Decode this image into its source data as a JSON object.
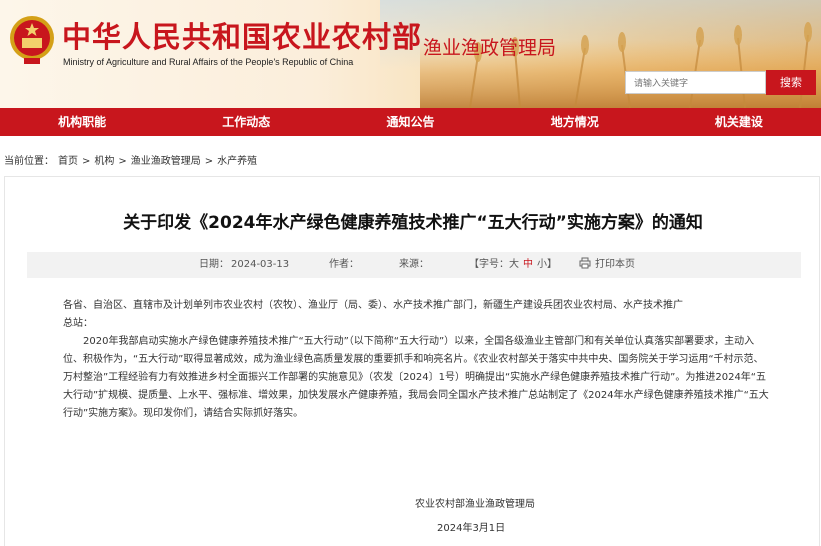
{
  "header": {
    "title_cn": "中华人民共和国农业农村部",
    "title_en": "Ministry of Agriculture and Rural Affairs of the People's Republic of China",
    "dept_name": "渔业渔政管理局",
    "search_placeholder": "请输入关键字",
    "search_button": "搜索",
    "emblem_icon": "national-emblem-icon"
  },
  "nav": {
    "items": [
      "机构职能",
      "工作动态",
      "通知公告",
      "地方情况",
      "机关建设"
    ]
  },
  "breadcrumb": {
    "prefix": "当前位置：",
    "items": [
      "首页",
      "机构",
      "渔业渔政管理局",
      "水产养殖"
    ],
    "separator": ">"
  },
  "article": {
    "title": "关于印发《2024年水产绿色健康养殖技术推广“五大行动”实施方案》的通知",
    "date_label": "日期：",
    "date_value": "2024-03-13",
    "author_label": "作者：",
    "source_label": "来源：",
    "font_label": "【字号：",
    "font_large": "大",
    "font_medium": "中",
    "font_small": "小",
    "font_close": "】",
    "print_label": "打印本页",
    "print_icon": "printer-icon",
    "salutation_line1": "各省、自治区、直辖市及计划单列市农业农村（农牧）、渔业厅（局、委）、水产技术推广部门，新疆生产建设兵团农业农村局、水产技术推广",
    "salutation_line2": "总站：",
    "paragraph": "2020年我部启动实施水产绿色健康养殖技术推广“五大行动”（以下简称“五大行动”）以来，全国各级渔业主管部门和有关单位认真落实部署要求，主动入位、积极作为，“五大行动”取得显著成效，成为渔业绿色高质量发展的重要抓手和响亮名片。《农业农村部关于落实中共中央、国务院关于学习运用“千村示范、万村整治”工程经验有力有效推进乡村全面振兴工作部署的实施意见》（农发〔2024〕1号）明确提出“实施水产绿色健康养殖技术推广行动”。为推进2024年“五大行动”扩规模、提质量、上水平、强标准、增效果，加快发展水产健康养殖，我局会同全国水产技术推广总站制定了《2024年水产绿色健康养殖技术推广“五大行动”实施方案》。现印发你们，请结合实际抓好落实。",
    "signature": "农业农村部渔业渔政管理局",
    "sign_date": "2024年3月1日"
  },
  "colors": {
    "brand_red": "#c8161d",
    "meta_bg": "#f2f2f2"
  }
}
